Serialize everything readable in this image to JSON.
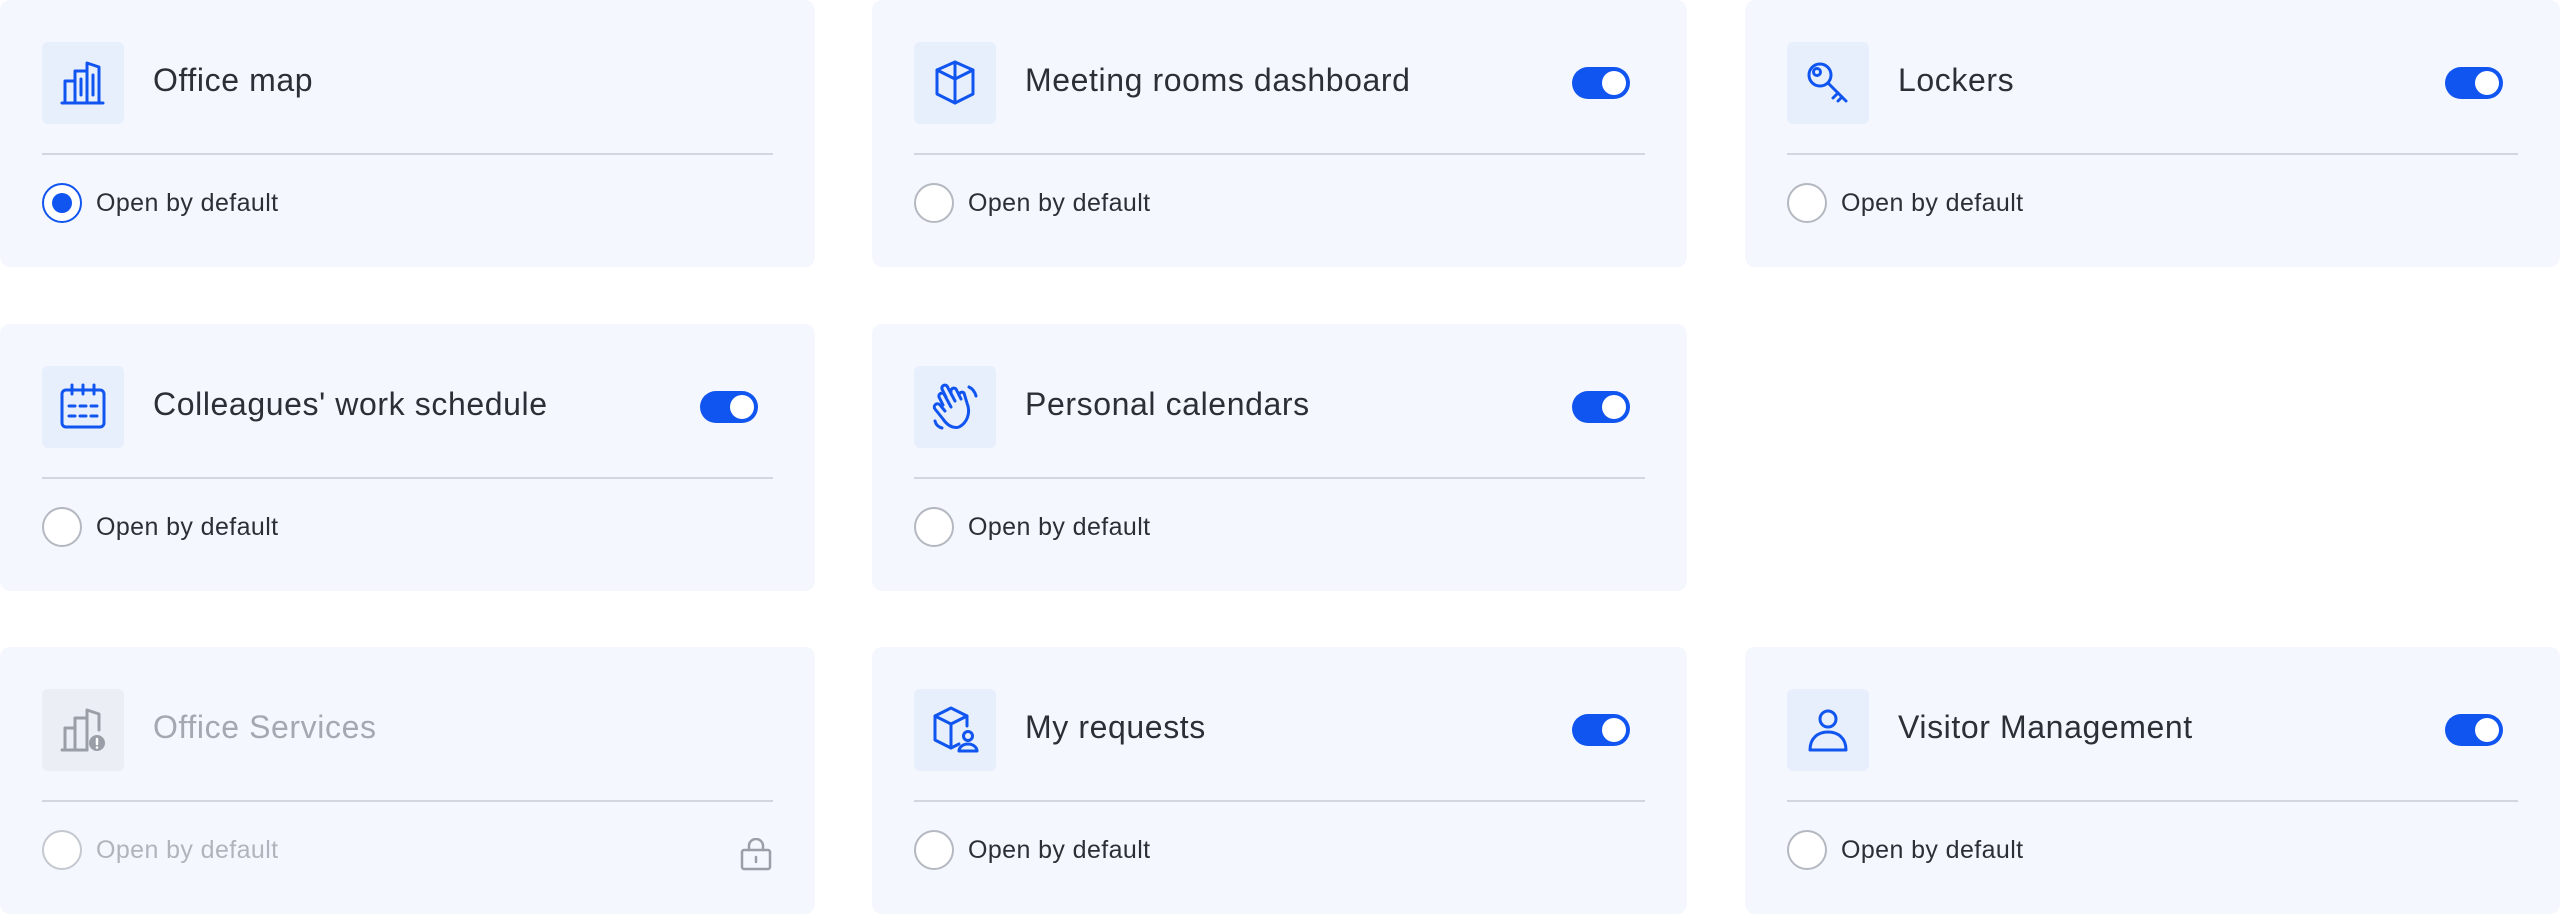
{
  "accent_color": "#1155f0",
  "disabled_color": "#a4a8b0",
  "cards": [
    {
      "title": "Office map",
      "icon": "office-building-icon",
      "toggle": null,
      "open_by_default": true,
      "disabled": false,
      "radio_label": "Open by default"
    },
    {
      "title": "Meeting rooms dashboard",
      "icon": "cube-icon",
      "toggle": true,
      "open_by_default": false,
      "disabled": false,
      "radio_label": "Open by default"
    },
    {
      "title": "Lockers",
      "icon": "key-icon",
      "toggle": true,
      "open_by_default": false,
      "disabled": false,
      "radio_label": "Open by default"
    },
    {
      "title": "Colleagues' work schedule",
      "icon": "calendar-icon",
      "toggle": true,
      "open_by_default": false,
      "disabled": false,
      "radio_label": "Open by default"
    },
    {
      "title": "Personal calendars",
      "icon": "waving-hand-icon",
      "toggle": true,
      "open_by_default": false,
      "disabled": false,
      "radio_label": "Open by default"
    },
    {
      "title": "Office Services",
      "icon": "office-services-icon",
      "toggle": null,
      "open_by_default": false,
      "disabled": true,
      "radio_label": "Open by default",
      "locked": true
    },
    {
      "title": "My requests",
      "icon": "requests-cube-user-icon",
      "toggle": true,
      "open_by_default": false,
      "disabled": false,
      "radio_label": "Open by default"
    },
    {
      "title": "Visitor Management",
      "icon": "person-icon",
      "toggle": true,
      "open_by_default": false,
      "disabled": false,
      "radio_label": "Open by default"
    }
  ]
}
